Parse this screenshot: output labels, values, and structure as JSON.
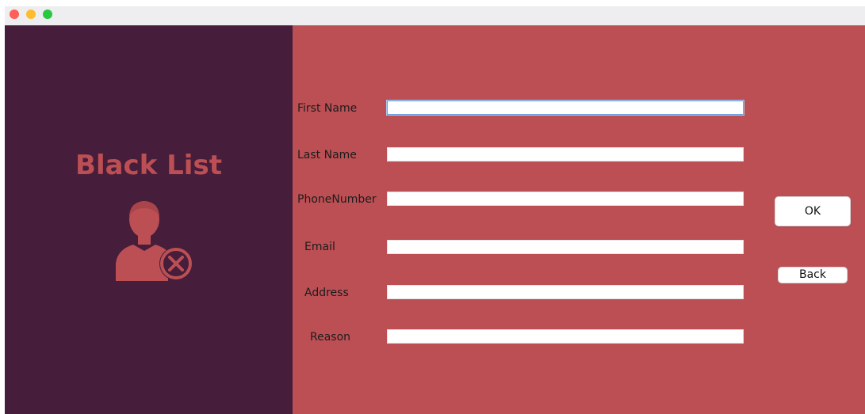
{
  "window": {
    "controls": [
      "close",
      "minimize",
      "zoom"
    ]
  },
  "sidebar": {
    "title": "Black List",
    "icon": "user-blocked-icon",
    "title_color": "#bc4f54",
    "background": "#461d3a"
  },
  "form": {
    "background": "#bc4f54",
    "fields": [
      {
        "label": "First Name",
        "value": ""
      },
      {
        "label": "Last Name",
        "value": ""
      },
      {
        "label": "PhoneNumber",
        "value": ""
      },
      {
        "label": "Email",
        "value": ""
      },
      {
        "label": "Address",
        "value": ""
      },
      {
        "label": "Reason",
        "value": ""
      }
    ]
  },
  "buttons": {
    "ok": "OK",
    "back": "Back"
  }
}
